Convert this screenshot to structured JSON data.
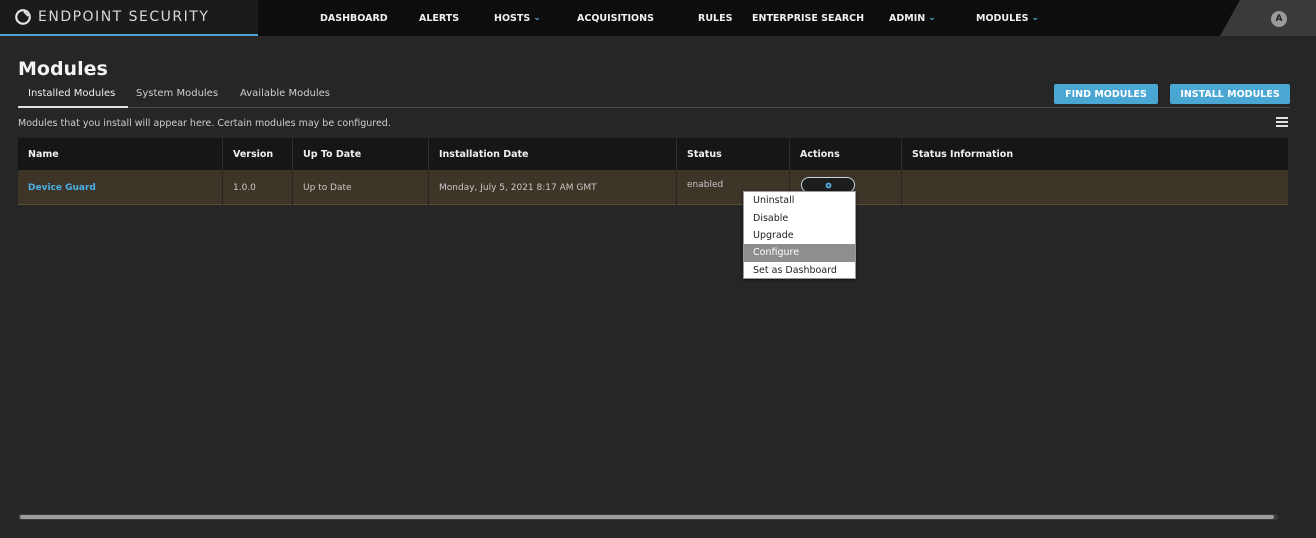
{
  "topbar": {
    "brand": "ENDPOINT SECURITY",
    "nav": [
      {
        "label": "DASHBOARD",
        "dropdown": false
      },
      {
        "label": "ALERTS",
        "dropdown": false
      },
      {
        "label": "HOSTS",
        "dropdown": true
      },
      {
        "label": "ACQUISITIONS",
        "dropdown": false
      },
      {
        "label": "RULES",
        "dropdown": false
      },
      {
        "label": "ENTERPRISE SEARCH",
        "dropdown": false
      },
      {
        "label": "ADMIN",
        "dropdown": true
      },
      {
        "label": "MODULES",
        "dropdown": true
      }
    ],
    "avatar": "A",
    "chevron": "⌄"
  },
  "page": {
    "title": "Modules",
    "tabs": [
      "Installed Modules",
      "System Modules",
      "Available Modules"
    ],
    "active_tab": "Installed Modules",
    "description": "Modules that you install will appear here. Certain modules may be configured.",
    "buttons": {
      "find": "FIND MODULES",
      "install": "INSTALL MODULES"
    }
  },
  "table": {
    "columns": [
      "Name",
      "Version",
      "Up To Date",
      "Installation Date",
      "Status",
      "Actions",
      "Status Information"
    ],
    "rows": [
      {
        "name": "Device Guard",
        "version": "1.0.0",
        "up_to_date": "Up to Date",
        "installation_date": "Monday, July 5, 2021 8:17 AM GMT",
        "status": "enabled",
        "status_information": ""
      }
    ]
  },
  "actions_menu": {
    "items": [
      "Uninstall",
      "Disable",
      "Upgrade",
      "Configure",
      "Set as Dashboard"
    ],
    "highlighted": "Configure"
  },
  "colors": {
    "accent": "#4aa6d3",
    "link": "#4ab0e6",
    "row_highlight": "#3d3528",
    "background": "#262626"
  },
  "icons": [
    "logo-icon",
    "chevron-down-icon",
    "list-view-icon",
    "gear-icon"
  ]
}
